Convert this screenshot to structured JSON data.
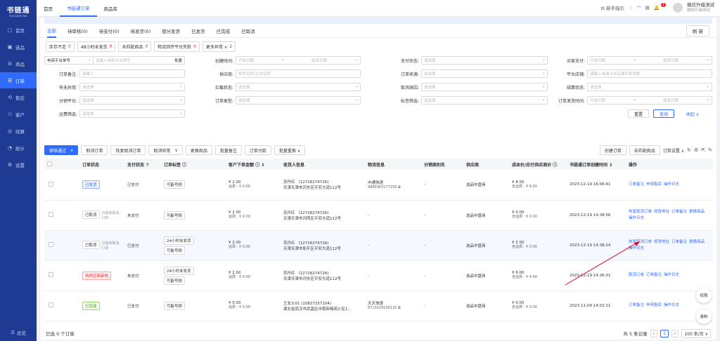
{
  "app": {
    "logo_title": "书链通",
    "logo_sub": "SHULIANTONG"
  },
  "sidebar": {
    "items": [
      {
        "icon": "▢",
        "label": "首页"
      },
      {
        "icon": "▣",
        "label": "选品"
      },
      {
        "icon": "⊟",
        "label": "商品"
      },
      {
        "icon": "☰",
        "label": "订单"
      },
      {
        "icon": "⟲",
        "label": "售后"
      },
      {
        "icon": "⚇",
        "label": "客户"
      },
      {
        "icon": "◎",
        "label": "结算"
      },
      {
        "icon": "◔",
        "label": "统计"
      },
      {
        "icon": "⚙",
        "label": "设置"
      }
    ],
    "bottom_label": "总览"
  },
  "topbar": {
    "tabs": [
      "首页",
      "书链通订单",
      "商品库"
    ],
    "guide": "新手指引",
    "notify_count": "1",
    "user_name": "微信升级测试",
    "user_role": "微信升级测试"
  },
  "status_tabs": [
    "全部",
    "待审核(0)",
    "待支付(0)",
    "待发货(0)",
    "部分发货",
    "已发货",
    "已完成",
    "已取消"
  ],
  "refresh_label": "刷 新",
  "chips": [
    {
      "label": "库存不足",
      "count": "0"
    },
    {
      "label": "48小时未发货",
      "count": "0"
    },
    {
      "label": "未匹配商品",
      "count": "0"
    },
    {
      "label": "物流回传平台失败",
      "count": "0"
    },
    {
      "label": "更多异常 ∨",
      "count": "2"
    }
  ],
  "filters": {
    "order_no_type": "电商平台单号",
    "order_no_ph": "请输入电商平台单号",
    "batch": "批量",
    "create_time": "创建时间:",
    "start_date": "开始日期",
    "end_date": "结束日期",
    "pay_status": "支付状态:",
    "buyer_pay": "买家支付:",
    "order_remark": "订单备注:",
    "order_remark_ph": "请输入",
    "supplier": "供应商:",
    "supplier_ph": "账号名称/公司名称",
    "order_source": "订单来源:",
    "platform_store": "平台店铺:",
    "platform_store_ph": "请输入电商平台店铺名称搜索",
    "has_exception": "有无异常:",
    "intercept_status": "拦截状态:",
    "cancel_reason": "取消原因:",
    "settle_status": "结算状态:",
    "distribute_platform": "分销平台:",
    "order_type": "订单类型:",
    "tag_filter": "标签筛选:",
    "order_ship_time": "订单发货时间:",
    "freight_filter": "运费筛选:",
    "select_ph": "请选择",
    "reset": "重置",
    "search": "查询",
    "collapse": "收起 ∧"
  },
  "toolbar": {
    "approve": "审核通过",
    "cancel_order": "取消订单",
    "restore_cancel": "恢复取消订单",
    "cancel_exception": "取消异常",
    "change_goods": "更换商品",
    "batch_remark": "批量备注",
    "order_pay": "订单付款",
    "batch_push": "批量重推 ∨",
    "create_order": "创建订单",
    "unmatched": "未匹配商品",
    "order_settings": "订单设置 ∨"
  },
  "table": {
    "headers": [
      "订单状态",
      "支付状态",
      "订单标签",
      "客户下单金额",
      "收货人信息",
      "物流信息",
      "分销商别名",
      "供应商",
      "成本价/应付供应商价",
      "书链通订单创建时间",
      "操作"
    ],
    "rows": [
      {
        "status": "已发货",
        "status_class": "blue",
        "status_sub": "",
        "pay": "已支付",
        "tags": [
          "可能号损"
        ],
        "amount": "¥ 2.00",
        "freight": "运费：¥ 0.00",
        "receiver": "苏丹红 （12728274726)",
        "address": "天津天津市河东区平安大道112号",
        "logistics": "中通快递",
        "logistics_no": "9889363177258",
        "alias": "-",
        "supplier": "选品中盘商",
        "cost": "¥ 8.00",
        "cost_freight": "含运费：¥ 6.00",
        "time": "2023-12-19 16:06:41",
        "actions": [
          "订单备注",
          "申请售后",
          "操作日志"
        ]
      },
      {
        "status": "已取消",
        "status_class": "gray",
        "status_sub": "分销商取消订单",
        "pay": "未支付",
        "tags": [
          "可能号损"
        ],
        "amount": "¥ 2.00",
        "freight": "运费：¥ 0.00",
        "receiver": "苏丹红 （12728274726)",
        "address": "天津天津市河西区平安大道112号",
        "logistics": "-",
        "logistics_no": "",
        "alias": "-",
        "supplier": "选品中盘商",
        "cost": "¥ 0.00",
        "cost_freight": "含运费：¥ 0.00",
        "time": "2023-12-19 14:38:56",
        "actions": [
          "恢复取消订单",
          "修改地址",
          "订单备注",
          "更换商品",
          "操作日志"
        ]
      },
      {
        "status": "已取消",
        "status_class": "gray",
        "status_sub": "分销商取消订单",
        "pay": "已支付",
        "tags": [
          "24小时未发货",
          "可能号损"
        ],
        "amount": "¥ 2.00",
        "freight": "运费：¥ 0.00",
        "receiver": "苏丹红 （12728274726)",
        "address": "天津天津市和平区平安大道112号",
        "logistics": "-",
        "logistics_no": "",
        "alias": "-",
        "supplier": "选品中盘商",
        "cost": "¥ 2.00",
        "cost_freight": "含运费：¥ 0.00",
        "time": "2023-12-19 14:38:24",
        "actions": [
          "恢复取消订单",
          "修改地址",
          "订单备注",
          "更换商品",
          "操作日志"
        ]
      },
      {
        "status": "待供应商审核",
        "status_class": "red",
        "status_sub": "",
        "pay": "未支付",
        "tags": [
          "24小时未发货",
          "可能号损"
        ],
        "amount": "¥ 2.00",
        "freight": "运费：¥ 0.00",
        "receiver": "苏丹红 （12728274726)",
        "address": "天津天津市河东区平安大道112号",
        "logistics": "-",
        "logistics_no": "",
        "alias": "-",
        "supplier": "选品中盘商",
        "cost": "¥ 6.00",
        "cost_freight": "含运费：¥ 4.00",
        "time": "2023-12-19 14:36:31",
        "actions": [
          "取消订单",
          "订单备注",
          "操作日志"
        ]
      },
      {
        "status": "已完成",
        "status_class": "green",
        "status_sub": "",
        "pay": "已支付",
        "tags": [
          "可能号损"
        ],
        "amount": "¥ 0.00",
        "freight": "运费：¥ 0.00",
        "receiver": "王女士01 (15827257104)",
        "address": "湖北省武汉市武昌区中南街梅苑小区1...",
        "logistics": "天天快递",
        "logistics_no": "8713029156132",
        "alias": "-",
        "supplier": "选品中盘商",
        "cost": "¥ 0.00",
        "cost_freight": "含运费：¥ 0.00",
        "time": "2023-11-09 14:02:11",
        "actions": [
          "订单备注",
          "申请售后",
          "操作日志"
        ]
      }
    ]
  },
  "footer": {
    "selected": "已选 0 个订单",
    "total": "共 5 条记录",
    "page": "1",
    "page_size": "100 条/页 ∨"
  },
  "floating": {
    "permissions": "权限",
    "record": "录制"
  }
}
